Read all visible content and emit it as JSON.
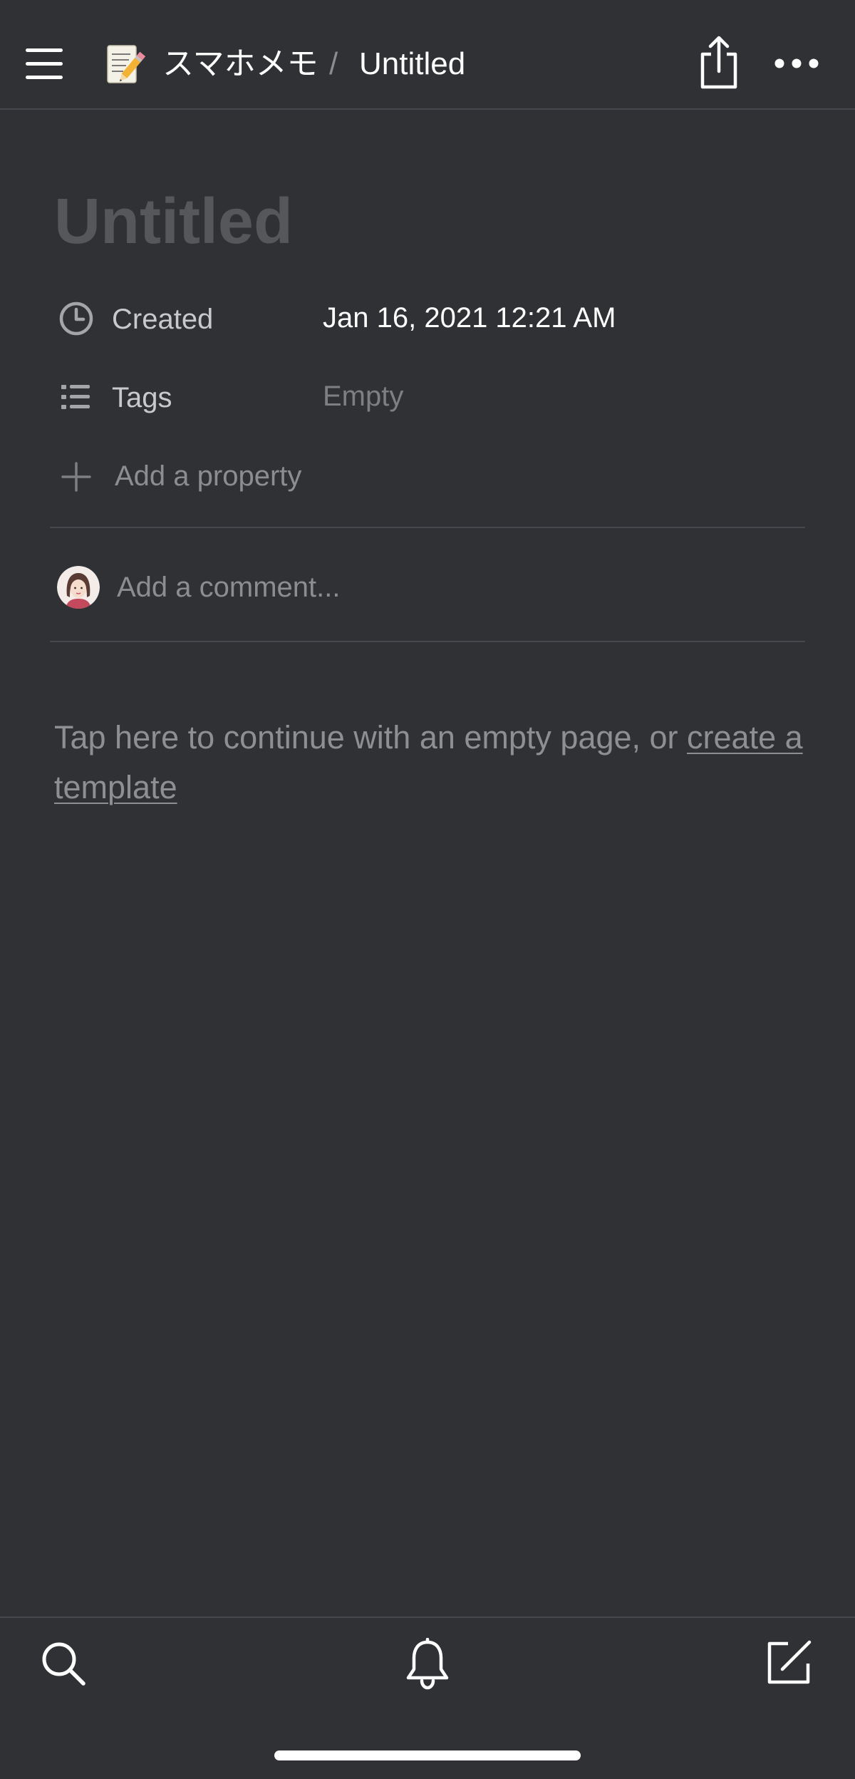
{
  "header": {
    "menu_icon": "hamburger-menu-icon",
    "page_emoji": "memo-emoji-icon",
    "breadcrumb_parent": "スマホメモ",
    "breadcrumb_separator": "/",
    "breadcrumb_current": "Untitled",
    "share_icon": "share-icon",
    "more_icon": "more-horizontal-icon"
  },
  "page": {
    "title": "Untitled",
    "properties": [
      {
        "icon": "clock-icon",
        "label": "Created",
        "value": "Jan 16, 2021 12:21 AM"
      },
      {
        "icon": "list-icon",
        "label": "Tags",
        "value": "Empty"
      }
    ],
    "add_property_label": "Add a property",
    "comment_placeholder": "Add a comment...",
    "empty_hint_text": "Tap here to continue with an empty page, or ",
    "template_link": "create a template"
  },
  "bottom_nav": {
    "search_icon": "search-icon",
    "notifications_icon": "bell-icon",
    "compose_icon": "compose-icon"
  },
  "colors": {
    "background": "#2f3135",
    "divider": "#46484d",
    "title_placeholder": "#55575b",
    "muted_text": "#8b8d90"
  }
}
